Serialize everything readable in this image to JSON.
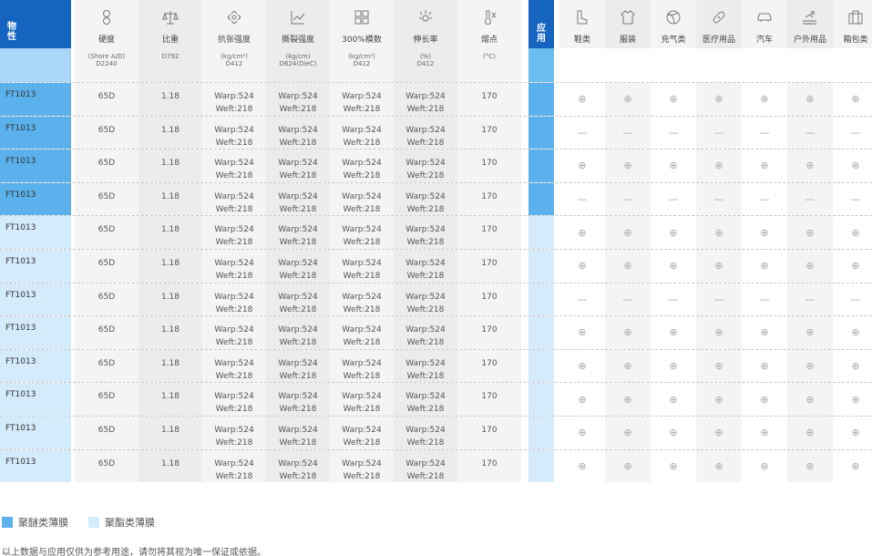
{
  "header": {
    "first_col": "物\n性",
    "application_label": "应\n用",
    "properties": [
      {
        "label": "硬度",
        "icon": "hardness-icon"
      },
      {
        "label": "比重",
        "icon": "scale-icon"
      },
      {
        "label": "抗张强度",
        "icon": "tensile-icon"
      },
      {
        "label": "撕裂强度",
        "icon": "tear-icon"
      },
      {
        "label": "300%模数",
        "icon": "modulus-icon"
      },
      {
        "label": "伸长率",
        "icon": "elongation-icon"
      },
      {
        "label": "熔点",
        "icon": "thermometer-icon"
      }
    ],
    "uses": [
      {
        "label": "鞋类",
        "icon": "boot-icon"
      },
      {
        "label": "服装",
        "icon": "shirt-icon"
      },
      {
        "label": "充气类",
        "icon": "ball-icon"
      },
      {
        "label": "医疗用品",
        "icon": "bandage-icon"
      },
      {
        "label": "汽车",
        "icon": "car-icon"
      },
      {
        "label": "户外用品",
        "icon": "swimmer-icon"
      },
      {
        "label": "箱包类",
        "icon": "luggage-icon"
      }
    ]
  },
  "units": [
    "(Shore A/D)\nD2240",
    "D792",
    "(kg/cm²)\nD412",
    "(kg/cm)\nD624(DieC)",
    "(kg/cm²)\nD412",
    "(%)\nD412",
    "(°C)"
  ],
  "rows": [
    {
      "type": "ether",
      "id": "FT1013",
      "hardness": "65D",
      "density": "1.18",
      "tensile": [
        "Warp:524",
        "Weft:218"
      ],
      "tear": [
        "Warp:524",
        "Weft:218"
      ],
      "modulus": [
        "Warp:524",
        "Weft:218"
      ],
      "elong": [
        "Warp:524",
        "Weft:218"
      ],
      "melt": "170",
      "uses": [
        "⊕",
        "⊕",
        "⊕",
        "⊕",
        "⊕",
        "⊕",
        "⊕"
      ]
    },
    {
      "type": "ether",
      "id": "FT1013",
      "hardness": "65D",
      "density": "1.18",
      "tensile": [
        "Warp:524",
        "Weft:218"
      ],
      "tear": [
        "Warp:524",
        "Weft:218"
      ],
      "modulus": [
        "Warp:524",
        "Weft:218"
      ],
      "elong": [
        "Warp:524",
        "Weft:218"
      ],
      "melt": "170",
      "uses": [
        "—",
        "—",
        "—",
        "—",
        "—",
        "—",
        "—"
      ]
    },
    {
      "type": "ether",
      "id": "FT1013",
      "hardness": "65D",
      "density": "1.18",
      "tensile": [
        "Warp:524",
        "Weft:218"
      ],
      "tear": [
        "Warp:524",
        "Weft:218"
      ],
      "modulus": [
        "Warp:524",
        "Weft:218"
      ],
      "elong": [
        "Warp:524",
        "Weft:218"
      ],
      "melt": "170",
      "uses": [
        "⊕",
        "⊕",
        "⊕",
        "⊕",
        "⊕",
        "⊕",
        "⊕"
      ]
    },
    {
      "type": "ether",
      "id": "FT1013",
      "hardness": "65D",
      "density": "1.18",
      "tensile": [
        "Warp:524",
        "Weft:218"
      ],
      "tear": [
        "Warp:524",
        "Weft:218"
      ],
      "modulus": [
        "Warp:524",
        "Weft:218"
      ],
      "elong": [
        "Warp:524",
        "Weft:218"
      ],
      "melt": "170",
      "uses": [
        "—",
        "—",
        "—",
        "—",
        "—",
        "—",
        "—"
      ]
    },
    {
      "type": "ester",
      "id": "FT1013",
      "hardness": "65D",
      "density": "1.18",
      "tensile": [
        "Warp:524",
        "Weft:218"
      ],
      "tear": [
        "Warp:524",
        "Weft:218"
      ],
      "modulus": [
        "Warp:524",
        "Weft:218"
      ],
      "elong": [
        "Warp:524",
        "Weft:218"
      ],
      "melt": "170",
      "uses": [
        "⊕",
        "⊕",
        "⊕",
        "⊕",
        "⊕",
        "⊕",
        "⊕"
      ]
    },
    {
      "type": "ester",
      "id": "FT1013",
      "hardness": "65D",
      "density": "1.18",
      "tensile": [
        "Warp:524",
        "Weft:218"
      ],
      "tear": [
        "Warp:524",
        "Weft:218"
      ],
      "modulus": [
        "Warp:524",
        "Weft:218"
      ],
      "elong": [
        "Warp:524",
        "Weft:218"
      ],
      "melt": "170",
      "uses": [
        "⊕",
        "⊕",
        "⊕",
        "⊕",
        "⊕",
        "⊕",
        "⊕"
      ]
    },
    {
      "type": "ester",
      "id": "FT1013",
      "hardness": "65D",
      "density": "1.18",
      "tensile": [
        "Warp:524",
        "Weft:218"
      ],
      "tear": [
        "Warp:524",
        "Weft:218"
      ],
      "modulus": [
        "Warp:524",
        "Weft:218"
      ],
      "elong": [
        "Warp:524",
        "Weft:218"
      ],
      "melt": "170",
      "uses": [
        "—",
        "—",
        "—",
        "—",
        "—",
        "—",
        "—"
      ]
    },
    {
      "type": "ester",
      "id": "FT1013",
      "hardness": "65D",
      "density": "1.18",
      "tensile": [
        "Warp:524",
        "Weft:218"
      ],
      "tear": [
        "Warp:524",
        "Weft:218"
      ],
      "modulus": [
        "Warp:524",
        "Weft:218"
      ],
      "elong": [
        "Warp:524",
        "Weft:218"
      ],
      "melt": "170",
      "uses": [
        "⊕",
        "⊕",
        "⊕",
        "⊕",
        "⊕",
        "⊕",
        "⊕"
      ]
    },
    {
      "type": "ester",
      "id": "FT1013",
      "hardness": "65D",
      "density": "1.18",
      "tensile": [
        "Warp:524",
        "Weft:218"
      ],
      "tear": [
        "Warp:524",
        "Weft:218"
      ],
      "modulus": [
        "Warp:524",
        "Weft:218"
      ],
      "elong": [
        "Warp:524",
        "Weft:218"
      ],
      "melt": "170",
      "uses": [
        "⊕",
        "⊕",
        "⊕",
        "⊕",
        "⊕",
        "⊕",
        "⊕"
      ]
    },
    {
      "type": "ester",
      "id": "FT1013",
      "hardness": "65D",
      "density": "1.18",
      "tensile": [
        "Warp:524",
        "Weft:218"
      ],
      "tear": [
        "Warp:524",
        "Weft:218"
      ],
      "modulus": [
        "Warp:524",
        "Weft:218"
      ],
      "elong": [
        "Warp:524",
        "Weft:218"
      ],
      "melt": "170",
      "uses": [
        "⊕",
        "⊕",
        "⊕",
        "⊕",
        "⊕",
        "⊕",
        "⊕"
      ]
    },
    {
      "type": "ester",
      "id": "FT1013",
      "hardness": "65D",
      "density": "1.18",
      "tensile": [
        "Warp:524",
        "Weft:218"
      ],
      "tear": [
        "Warp:524",
        "Weft:218"
      ],
      "modulus": [
        "Warp:524",
        "Weft:218"
      ],
      "elong": [
        "Warp:524",
        "Weft:218"
      ],
      "melt": "170",
      "uses": [
        "⊕",
        "⊕",
        "⊕",
        "⊕",
        "⊕",
        "⊕",
        "⊕"
      ]
    },
    {
      "type": "ester",
      "id": "FT1013",
      "hardness": "65D",
      "density": "1.18",
      "tensile": [
        "Warp:524",
        "Weft:218"
      ],
      "tear": [
        "Warp:524",
        "Weft:218"
      ],
      "modulus": [
        "Warp:524",
        "Weft:218"
      ],
      "elong": [
        "Warp:524",
        "Weft:218"
      ],
      "melt": "170",
      "uses": [
        "⊕",
        "⊕",
        "⊕",
        "⊕",
        "⊕",
        "⊕",
        "⊕"
      ]
    }
  ],
  "legend": {
    "ether_label": "聚醚类薄膜",
    "ester_label": "聚酯类薄膜",
    "ether_color": "#5ab1ec",
    "ester_color": "#d4ebfb"
  },
  "note": "以上数据与应用仅供为参考用途，请勿将其视为唯一保证或依据。",
  "colors": {
    "header_blue": "#1565c0",
    "unit_blue": "#aad7f7",
    "app_blue": "#6bbcef"
  }
}
